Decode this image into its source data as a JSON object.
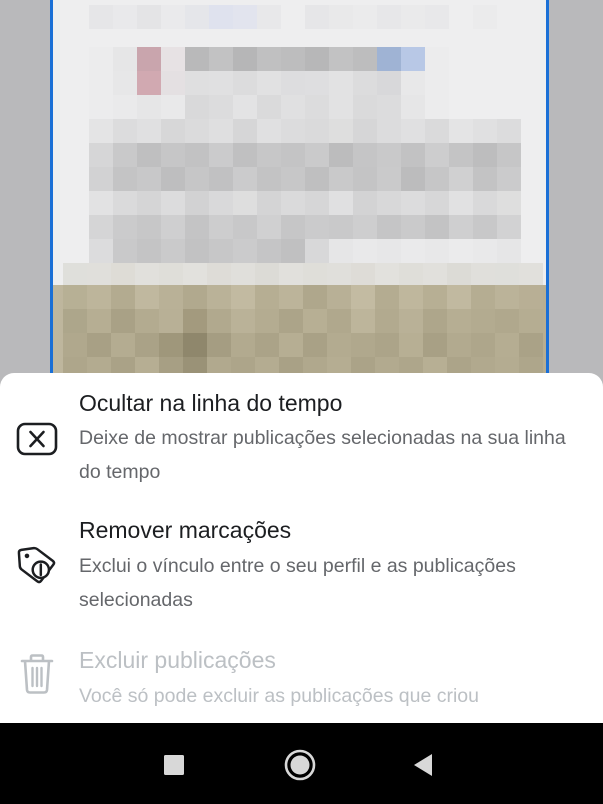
{
  "sheet": {
    "options": [
      {
        "title": "Ocultar na linha do tempo",
        "description": "Deixe de mostrar publicações selecionadas na sua linha do tempo",
        "icon": "hide-box-icon",
        "enabled": true
      },
      {
        "title": "Remover marcações",
        "description": "Exclui o vínculo entre o seu perfil e as publicações selecionadas",
        "icon": "tag-remove-icon",
        "enabled": true
      },
      {
        "title": "Excluir publicações",
        "description": "Você só pode excluir as publicações que criou",
        "icon": "trash-icon",
        "enabled": false
      }
    ]
  },
  "navbar": {
    "icons": [
      "recents-square-icon",
      "home-circle-icon",
      "back-triangle-icon"
    ]
  },
  "colors": {
    "selection_border": "#1a6fd6",
    "title_text": "#1c1e21",
    "description_text": "#65676b",
    "disabled_text": "#bcc0c4"
  }
}
